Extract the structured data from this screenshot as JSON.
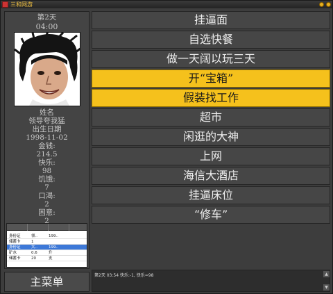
{
  "window": {
    "title": "三和网游"
  },
  "status": {
    "day": "第2天",
    "time": "04:00",
    "name_label": "姓名",
    "name_value": "领导夸我猛",
    "birth_label": "出生日期",
    "birth_value": "1998-11-02",
    "money_label": "金钱:",
    "money_value": "214.5",
    "happy_label": "快乐:",
    "happy_value": "98",
    "hunger_label": "饥饿:",
    "hunger_value": "7",
    "thirst_label": "口渴:",
    "thirst_value": "2",
    "sleepy_label": "困意:",
    "sleepy_value": "2"
  },
  "inventory": {
    "rows": [
      {
        "c1": "身份证",
        "c2": "领..",
        "c3": "199.."
      },
      {
        "c1": "储蓄卡",
        "c2": "1",
        "c3": ""
      },
      {
        "c1": "身份证",
        "c2": "大..",
        "c3": "199.."
      },
      {
        "c1": "矿水",
        "c2": "0.6",
        "c3": "升"
      },
      {
        "c1": "储蓄卡",
        "c2": "20",
        "c3": "支"
      }
    ]
  },
  "actions": [
    {
      "label": "挂逼面",
      "highlighted": false
    },
    {
      "label": "自选快餐",
      "highlighted": false
    },
    {
      "label": "做一天阔以玩三天",
      "highlighted": false
    },
    {
      "label": "开“宝箱”",
      "highlighted": true
    },
    {
      "label": "假装找工作",
      "highlighted": true
    },
    {
      "label": "超市",
      "highlighted": false
    },
    {
      "label": "闲逛的大神",
      "highlighted": false
    },
    {
      "label": "上网",
      "highlighted": false
    },
    {
      "label": "海信大酒店",
      "highlighted": false
    },
    {
      "label": "挂逼床位",
      "highlighted": false
    },
    {
      "label": "“修车”",
      "highlighted": false
    }
  ],
  "main_menu_label": "主菜单",
  "log": {
    "text": "第2天 03:54 快乐:-1, 快乐=98"
  },
  "colors": {
    "highlight": "#f5c11c",
    "panel": "#464646"
  }
}
